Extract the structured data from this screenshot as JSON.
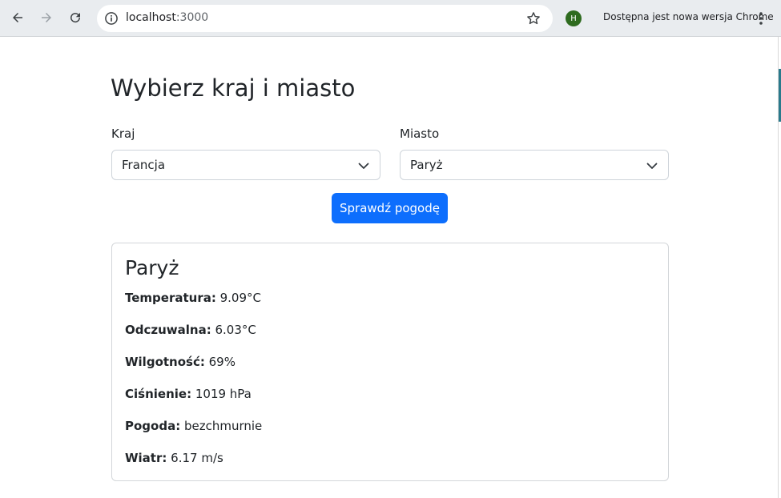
{
  "browser": {
    "url_host": "localhost",
    "url_port": ":3000",
    "profile_initial": "H",
    "update_notice": "Dostępna jest nowa wersja Chrome"
  },
  "page": {
    "title": "Wybierz kraj i miasto",
    "country_label": "Kraj",
    "country_value": "Francja",
    "city_label": "Miasto",
    "city_value": "Paryż",
    "submit_label": "Sprawdź pogodę"
  },
  "weather": {
    "city": "Paryż",
    "rows": [
      {
        "label": "Temperatura:",
        "value": "9.09°C"
      },
      {
        "label": "Odczuwalna:",
        "value": "6.03°C"
      },
      {
        "label": "Wilgotność:",
        "value": "69%"
      },
      {
        "label": "Ciśnienie:",
        "value": "1019 hPa"
      },
      {
        "label": "Pogoda:",
        "value": "bezchmurnie"
      },
      {
        "label": "Wiatr:",
        "value": "6.17 m/s"
      }
    ]
  },
  "colors": {
    "primary": "#0d6efd",
    "avatar": "#2e6b1f"
  }
}
